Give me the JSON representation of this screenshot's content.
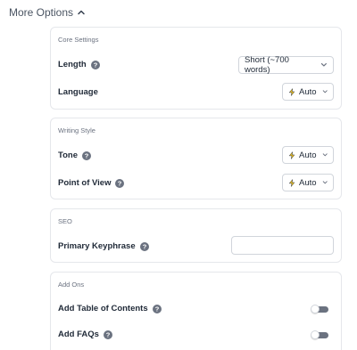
{
  "more_options": {
    "label": "More Options"
  },
  "core_settings": {
    "title": "Core Settings",
    "length": {
      "label": "Length",
      "value": "Short (~700 words)"
    },
    "language": {
      "label": "Language",
      "value": "Auto"
    }
  },
  "writing_style": {
    "title": "Writing Style",
    "tone": {
      "label": "Tone",
      "value": "Auto"
    },
    "point_of_view": {
      "label": "Point of View",
      "value": "Auto"
    }
  },
  "seo": {
    "title": "SEO",
    "primary_keyphrase": {
      "label": "Primary Keyphrase",
      "value": ""
    }
  },
  "add_ons": {
    "title": "Add Ons",
    "table_of_contents": {
      "label": "Add Table of Contents",
      "enabled": false
    },
    "faqs": {
      "label": "Add FAQs",
      "enabled": false
    }
  },
  "colors": {
    "bolt": "#f5c518",
    "help_icon": "#6b7280",
    "toggle_track": "#6b7280"
  }
}
